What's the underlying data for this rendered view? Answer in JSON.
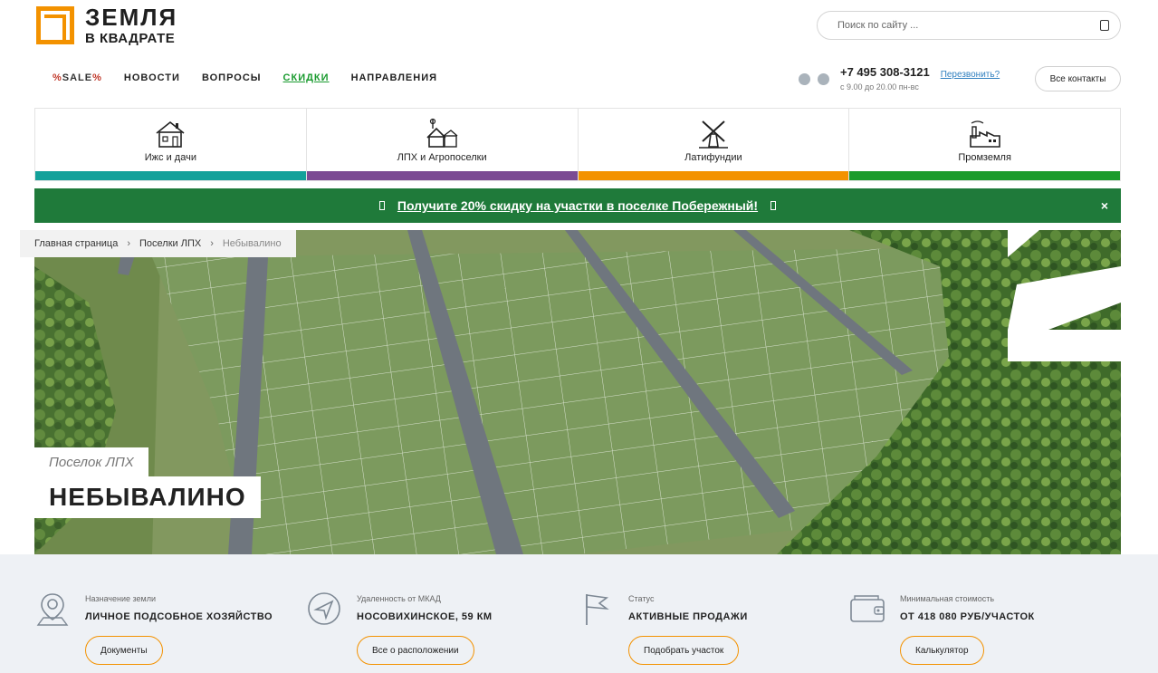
{
  "header": {
    "logo_line1": "ЗЕМЛЯ",
    "logo_line2": "В КВАДРАТЕ",
    "search_placeholder": "Поиск по сайту ..."
  },
  "nav": {
    "sale_prefix": "%",
    "sale_label": "SALE",
    "sale_suffix": "%",
    "items": [
      "НОВОСТИ",
      "ВОПРОСЫ",
      "СКИДКИ",
      "НАПРАВЛЕНИЯ"
    ]
  },
  "contacts": {
    "phone": "+7 495 308-3121",
    "hours": "с 9.00 до 20.00 пн-вс",
    "callback": "Перезвонить?",
    "all_contacts": "Все контакты"
  },
  "categories": [
    {
      "label": "Ижс и дачи",
      "color": "#13a19a",
      "icon": "house-icon"
    },
    {
      "label": "ЛПХ и Агропоселки",
      "color": "#7b4a93",
      "icon": "farm-icon"
    },
    {
      "label": "Латифундии",
      "color": "#f39200",
      "icon": "windmill-icon"
    },
    {
      "label": "Промземля",
      "color": "#1b9b2c",
      "icon": "factory-icon"
    }
  ],
  "promo": {
    "text": "Получите 20% скидку на участки в поселке Побережный!",
    "close": "×",
    "color": "#1f7a3a"
  },
  "breadcrumb": {
    "home": "Главная страница",
    "section": "Поселки ЛПХ",
    "current": "Небывалино",
    "separator": "›"
  },
  "hero": {
    "subtitle": "Поселок ЛПХ",
    "title": "НЕБЫВАЛИНО"
  },
  "info": [
    {
      "label": "Назначение земли",
      "value": "ЛИЧНОЕ ПОДСОБНОЕ ХОЗЯЙСТВО",
      "button": "Документы",
      "icon": "location-pin-icon"
    },
    {
      "label": "Удаленность от МКАД",
      "value": "НОСОВИХИНСКОЕ, 59 КМ",
      "button": "Все о расположении",
      "icon": "navigation-icon"
    },
    {
      "label": "Статус",
      "value": "АКТИВНЫЕ ПРОДАЖИ",
      "button": "Подобрать участок",
      "icon": "flag-icon"
    },
    {
      "label": "Минимальная стоимость",
      "value": "ОТ 418 080 РУБ/УЧАСТОК",
      "button": "Калькулятор",
      "icon": "wallet-icon"
    }
  ],
  "colors": {
    "accent": "#f39200",
    "link": "#2f7fbf",
    "discount": "#1a9b2f"
  }
}
